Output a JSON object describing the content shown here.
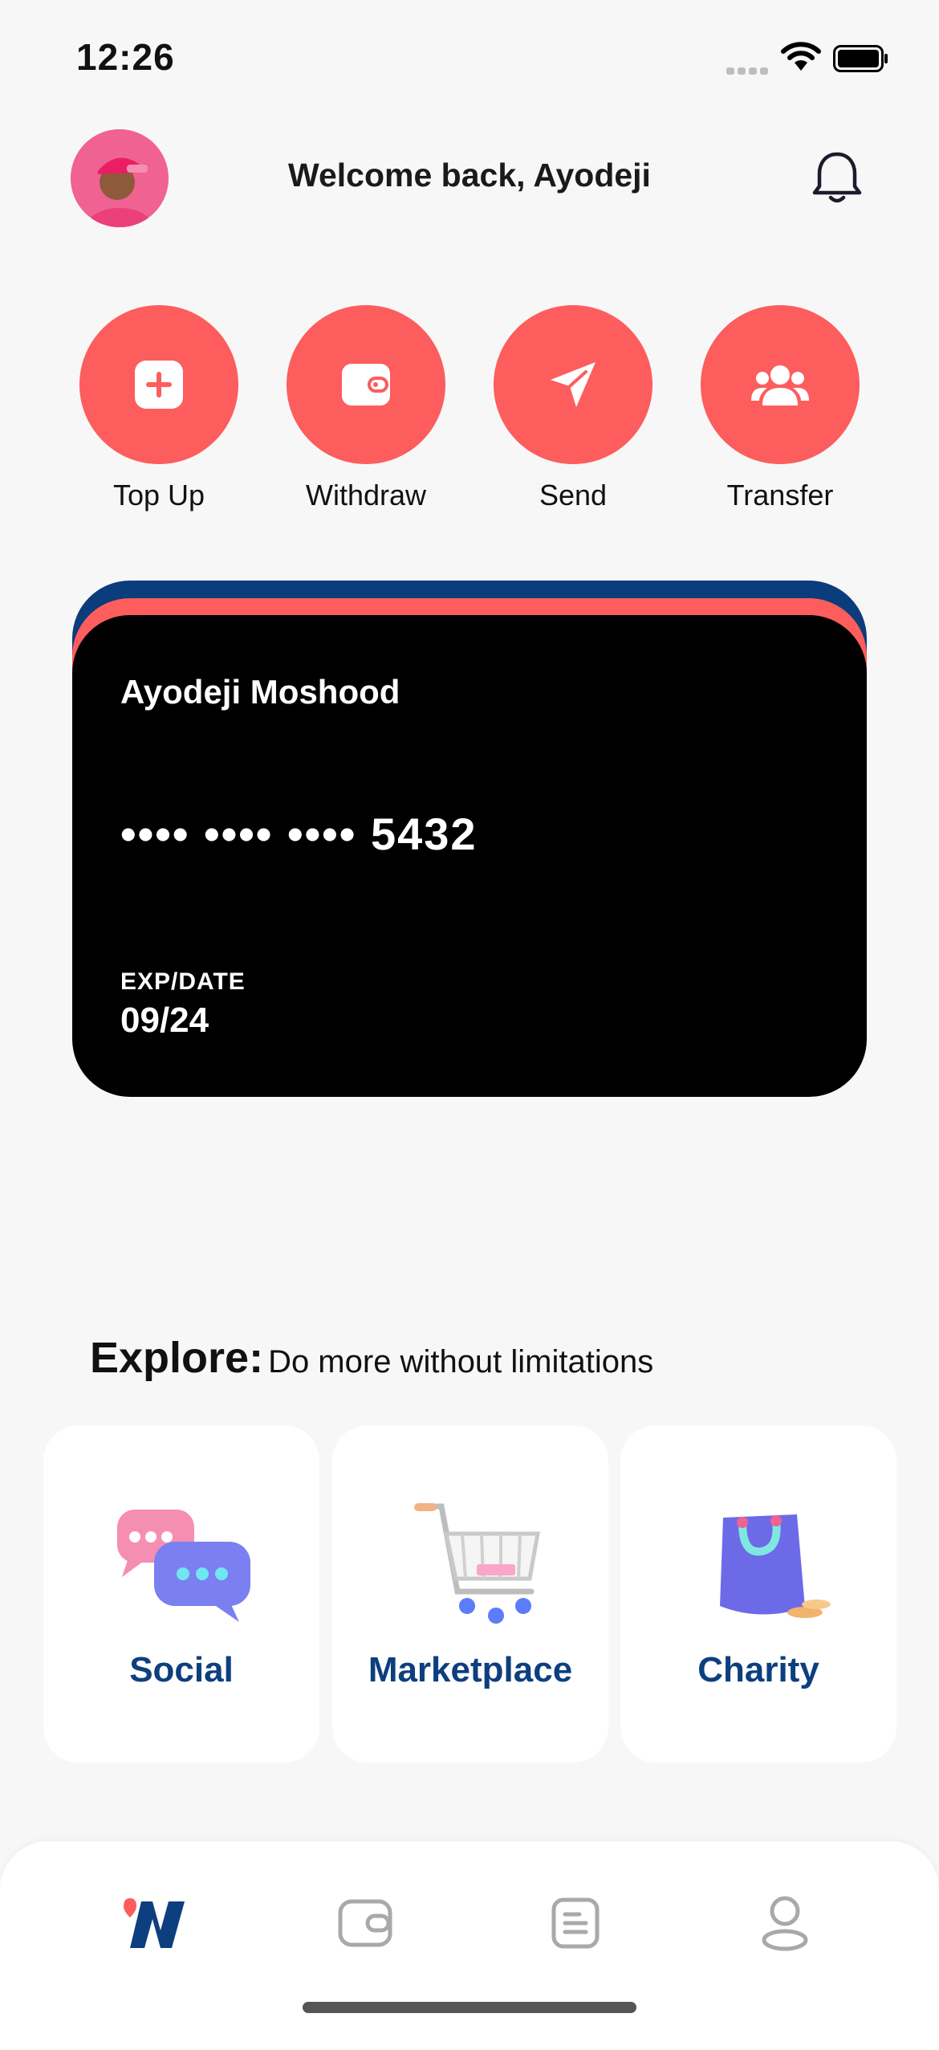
{
  "status_bar": {
    "time": "12:26"
  },
  "header": {
    "welcome": "Welcome back, Ayodeji",
    "bell_icon": "bell-icon",
    "avatar_icon": "user-avatar"
  },
  "actions": [
    {
      "label": "Top Up",
      "icon": "plus-square-icon"
    },
    {
      "label": "Withdraw",
      "icon": "wallet-icon"
    },
    {
      "label": "Send",
      "icon": "send-icon"
    },
    {
      "label": "Transfer",
      "icon": "users-icon"
    }
  ],
  "card": {
    "holder": "Ayodeji Moshood",
    "number": "•••• •••• •••• 5432",
    "exp_label": "EXP/DATE",
    "exp_value": "09/24",
    "colors": {
      "front": "#000000",
      "middle": "#fd5d5d",
      "back": "#0b3c7c"
    }
  },
  "explore": {
    "title": "Explore:",
    "subtitle": "Do more without limitations",
    "tiles": [
      {
        "label": "Social",
        "icon": "chat-bubbles-icon"
      },
      {
        "label": "Marketplace",
        "icon": "shopping-cart-icon"
      },
      {
        "label": "Charity",
        "icon": "shopping-bag-icon"
      }
    ]
  },
  "bottom_nav": [
    {
      "name": "home",
      "icon": "brand-logo-icon",
      "active": true
    },
    {
      "name": "wallet",
      "icon": "wallet-icon",
      "active": false
    },
    {
      "name": "transactions",
      "icon": "document-icon",
      "active": false
    },
    {
      "name": "profile",
      "icon": "user-icon",
      "active": false
    }
  ],
  "theme": {
    "accent": "#fd5d5d",
    "brand_blue": "#0d3f7e",
    "background": "#f7f7f7"
  }
}
